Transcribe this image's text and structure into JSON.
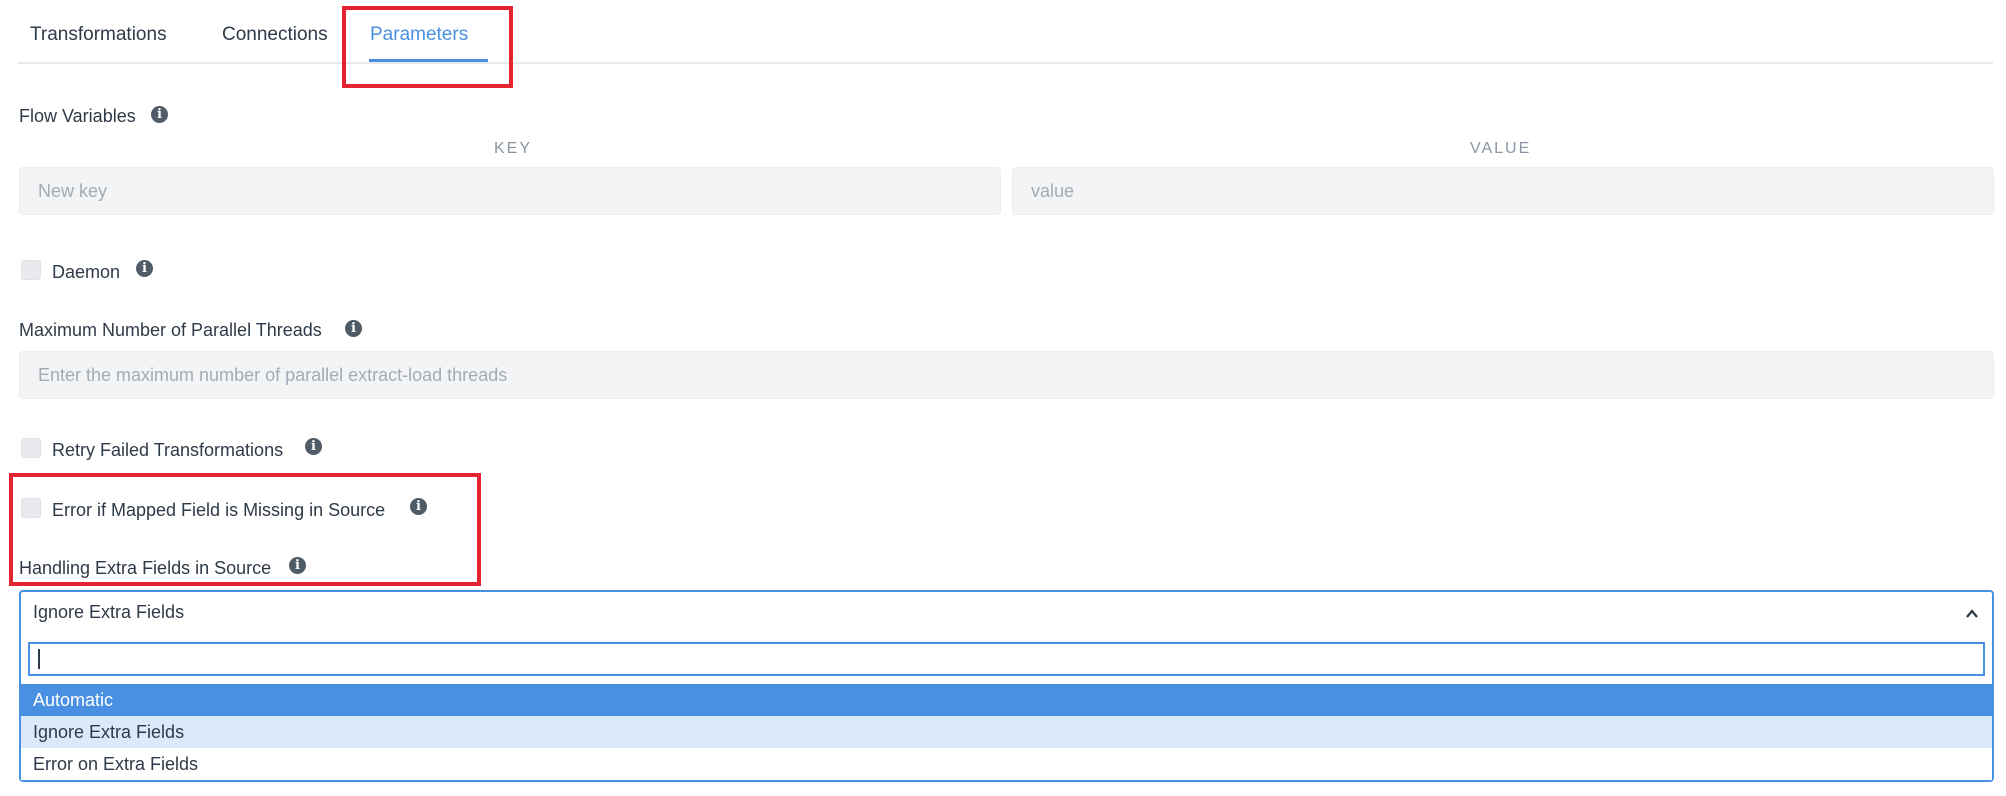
{
  "tabs": [
    {
      "label": "Transformations"
    },
    {
      "label": "Connections"
    },
    {
      "label": "Parameters"
    }
  ],
  "flow_variables": {
    "label": "Flow Variables",
    "key_header": "KEY",
    "value_header": "VALUE",
    "key_placeholder": "New key",
    "value_placeholder": "value"
  },
  "daemon": {
    "label": "Daemon",
    "checked": false
  },
  "max_threads": {
    "label": "Maximum Number of Parallel Threads",
    "placeholder": "Enter the maximum number of parallel extract-load threads"
  },
  "retry_failed": {
    "label": "Retry Failed Transformations",
    "checked": false
  },
  "error_missing": {
    "label": "Error if Mapped Field is Missing in Source",
    "checked": false
  },
  "extra_fields": {
    "label": "Handling Extra Fields in Source",
    "selected": "Ignore Extra Fields",
    "search_value": "",
    "options": [
      "Automatic",
      "Ignore Extra Fields",
      "Error on Extra Fields"
    ]
  },
  "icons": {
    "info": "info-icon",
    "chevron": "chevron-up-icon"
  },
  "colors": {
    "accent": "#4a90e2",
    "highlight": "#e3232f",
    "hover_row": "#dbe9fb"
  }
}
